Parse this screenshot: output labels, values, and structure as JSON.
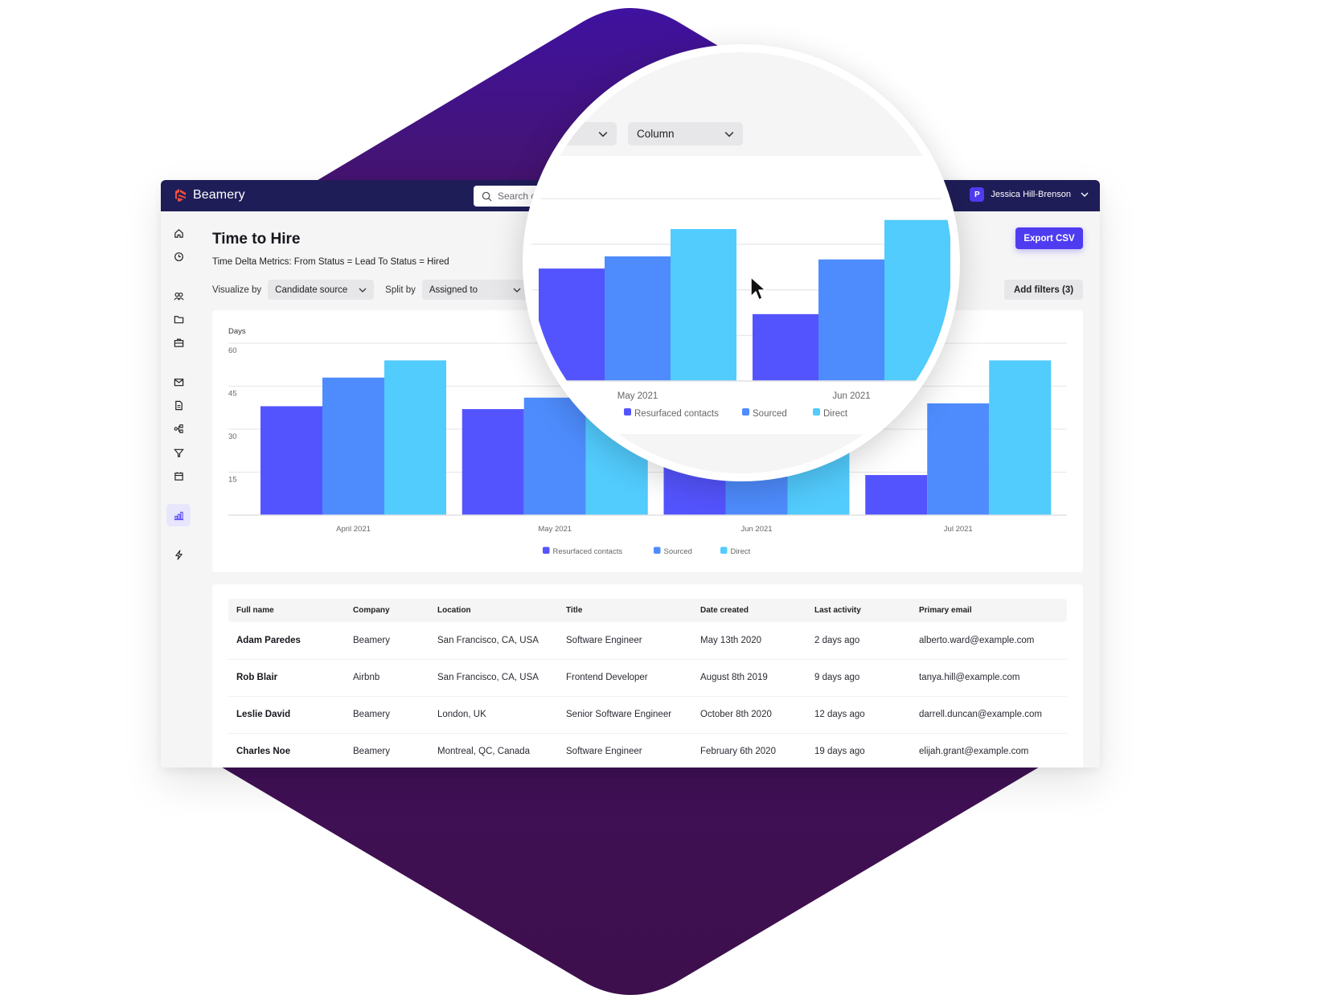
{
  "app": {
    "brand": "Beamery",
    "search_placeholder": "Search candidates",
    "user": {
      "initial": "P",
      "name": "Jessica Hill-Brenson"
    }
  },
  "sidebar": {
    "items": [
      {
        "icon": "home-icon",
        "label": "Home"
      },
      {
        "icon": "clock-icon",
        "label": "Recent"
      },
      {
        "icon": "people-icon",
        "label": "Contacts"
      },
      {
        "icon": "folder-icon",
        "label": "Pools"
      },
      {
        "icon": "briefcase-icon",
        "label": "Vacancies"
      },
      {
        "icon": "mail-icon",
        "label": "Messages"
      },
      {
        "icon": "document-icon",
        "label": "Forms"
      },
      {
        "icon": "flow-icon",
        "label": "Flows"
      },
      {
        "icon": "filter-icon",
        "label": "Pipelines"
      },
      {
        "icon": "calendar-icon",
        "label": "Calendar"
      },
      {
        "icon": "bar-chart-icon",
        "label": "Reports",
        "active": true
      },
      {
        "icon": "lightning-icon",
        "label": "Automations"
      }
    ]
  },
  "page": {
    "title": "Time to Hire",
    "subtitle": "Time Delta Metrics: From Status = Lead To Status = Hired",
    "visualize_label": "Visualize by",
    "visualize_value": "Candidate source",
    "split_label": "Split by",
    "split_value": "Assigned to",
    "chart_type_value": "Column",
    "export_label": "Export CSV",
    "add_filters_label": "Add filters (3)"
  },
  "chart_data": {
    "type": "bar",
    "title": "",
    "xlabel": "",
    "ylabel": "Days",
    "ylim": [
      0,
      60
    ],
    "yticks": [
      15,
      30,
      45,
      60
    ],
    "grid": true,
    "legend_position": "bottom",
    "categories": [
      "April 2021",
      "May 2021",
      "Jun 2021",
      "Jul 2021"
    ],
    "series": [
      {
        "name": "Resurfaced contacts",
        "color": "#5454fe",
        "values": [
          38,
          37,
          22,
          14
        ]
      },
      {
        "name": "Sourced",
        "color": "#4e8cfd",
        "values": [
          48,
          41,
          40,
          39
        ]
      },
      {
        "name": "Direct",
        "color": "#52cbfd",
        "values": [
          54,
          50,
          53,
          54
        ]
      }
    ]
  },
  "table": {
    "columns": [
      "Full name",
      "Company",
      "Location",
      "Title",
      "Date created",
      "Last activity",
      "Primary email"
    ],
    "rows": [
      [
        "Adam Paredes",
        "Beamery",
        "San Francisco, CA, USA",
        "Software Engineer",
        "May 13th 2020",
        "2 days ago",
        "alberto.ward@example.com"
      ],
      [
        "Rob Blair",
        "Airbnb",
        "San Francisco, CA, USA",
        "Frontend Developer",
        "August 8th 2019",
        "9 days ago",
        "tanya.hill@example.com"
      ],
      [
        "Leslie David",
        "Beamery",
        "London, UK",
        "Senior Software Engineer",
        "October 8th 2020",
        "12 days ago",
        "darrell.duncan@example.com"
      ],
      [
        "Charles Noe",
        "Beamery",
        "Montreal, QC, Canada",
        "Software Engineer",
        "February 6th 2020",
        "19 days ago",
        "elijah.grant@example.com"
      ]
    ]
  },
  "colors": {
    "accent": "#4f3cf0",
    "topbar": "#1f1d58",
    "hexagon": "#3f1158"
  }
}
